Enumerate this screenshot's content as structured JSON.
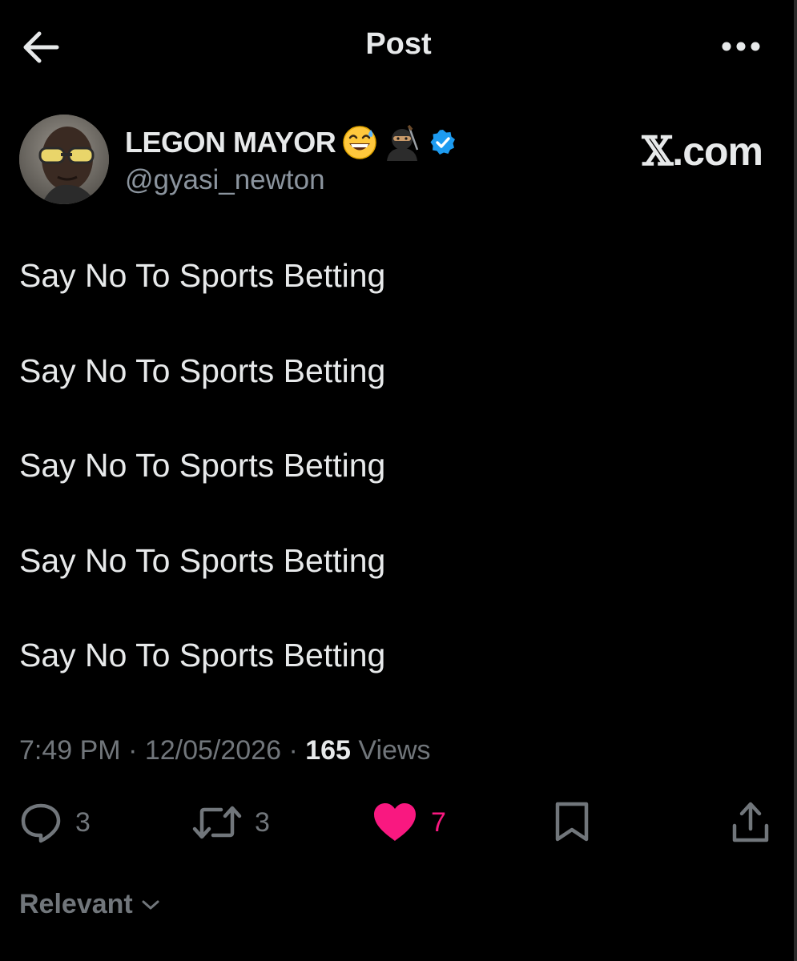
{
  "header": {
    "title": "Post"
  },
  "author": {
    "display_name": "LEGON MAYOR",
    "handle": "@gyasi_newton",
    "verified": true,
    "emojis": [
      "grinning-face-with-sweat-emoji",
      "ninja-emoji"
    ]
  },
  "watermark": {
    "logo": "𝕏",
    "text": ".com"
  },
  "post": {
    "lines": [
      "Say No To Sports Betting",
      "Say No To Sports Betting",
      "Say No To Sports Betting",
      "Say No To Sports Betting",
      "Say No To Sports Betting"
    ]
  },
  "meta": {
    "time": "7:49 PM",
    "date": "12/05/2026",
    "separator": " · ",
    "views_count": "165",
    "views_label": "Views"
  },
  "actions": {
    "reply_count": "3",
    "repost_count": "3",
    "like_count": "7"
  },
  "sort": {
    "label": "Relevant"
  },
  "colors": {
    "background": "#000000",
    "text": "#e7e9ea",
    "muted": "#71767b",
    "like": "#f91880",
    "verified": "#1d9bf0"
  }
}
